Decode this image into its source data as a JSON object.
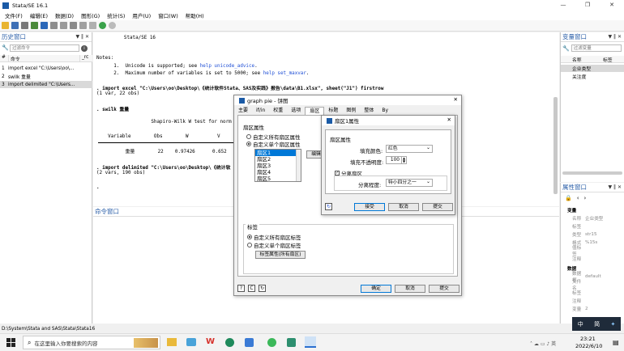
{
  "window": {
    "title": "Stata/SE 16.1",
    "min": "—",
    "max": "❐",
    "close": "✕"
  },
  "menu": [
    "文件(F)",
    "编辑(E)",
    "数据(D)",
    "图形(G)",
    "统计(S)",
    "用户(U)",
    "窗口(W)",
    "帮助(H)"
  ],
  "history": {
    "title": "历史窗口",
    "filter_placeholder": "过滤命令",
    "col_num": "#",
    "col_cmd": "命令",
    "col_rc": "_rc",
    "rows": [
      {
        "n": "1",
        "cmd": "import excel \"C:\\Users\\oo\\..."
      },
      {
        "n": "2",
        "cmd": "swilk 重量"
      },
      {
        "n": "3",
        "cmd": "import delimited \"C:\\Users..."
      }
    ]
  },
  "results": {
    "l1": "         Stata/SE 16",
    "notes": "Notes:",
    "n1a": "      1.  Unicode is supported; see ",
    "n1b": "help unicode_advice",
    "n1c": ".",
    "n2a": "      2.  Maximum number of variables is set to 5000; see ",
    "n2b": "help set_maxvar",
    "n2c": ".",
    "cmd1": ". import excel \"C:\\Users\\oo\\Desktop\\《统计软件Stata、SAS及实践》报告\\data\\B1.xlsx\", sheet(\"J1\") firstrow",
    "out1": "(1 var, 22 obs)",
    "cmd2": ". swilk 重量",
    "sw_title": "                   Shapiro-Wilk W test for norm",
    "sw_head": "    Variable        Obs        W          V",
    "sw_row": "          重量        22    0.97426      0.652",
    "cmd3": ". import delimited \"C:\\Users\\oo\\Desktop\\《统计软",
    "out3": "(2 vars, 190 obs)",
    "dot": "."
  },
  "command": {
    "title": "命令窗口"
  },
  "variables": {
    "title": "变量窗口",
    "filter_placeholder": "过滤变量",
    "col_name": "名称",
    "col_label": "标签",
    "rows": [
      "企业类型",
      "关注度"
    ]
  },
  "properties": {
    "title": "属性窗口",
    "sec_var": "变量",
    "var_rows": [
      {
        "k": "名称",
        "v": "企业类型"
      },
      {
        "k": "标签",
        "v": ""
      },
      {
        "k": "类型",
        "v": "str15"
      },
      {
        "k": "格式",
        "v": "%15s"
      },
      {
        "k": "值标签",
        "v": ""
      },
      {
        "k": "注释",
        "v": ""
      }
    ],
    "sec_data": "数据",
    "data_rows": [
      {
        "k": "数据框",
        "v": "default"
      },
      {
        "k": "文件名",
        "v": ""
      },
      {
        "k": "标签",
        "v": ""
      },
      {
        "k": "注释",
        "v": ""
      },
      {
        "k": "变量",
        "v": "2"
      }
    ]
  },
  "status": {
    "path": "D:\\System\\Stata and SAS\\Stata\\Stata16"
  },
  "taskbar": {
    "search": "在这里输入你要搜索的内容",
    "time": "23:21",
    "date": "2022/6/10"
  },
  "ime": {
    "a": "中",
    "b": "简"
  },
  "pie": {
    "title": "graph pie - 饼图",
    "tabs": [
      "主要",
      "if/in",
      "权重",
      "选项",
      "扇区",
      "标题",
      "图例",
      "整体",
      "By"
    ],
    "slice_group": "扇区属性",
    "opt_all": "自定义所有扇区属性",
    "opt_single": "自定义单个扇区属性",
    "slices": [
      "扇区1",
      "扇区2",
      "扇区3",
      "扇区4",
      "扇区5"
    ],
    "edit": "编辑",
    "label_group": "标签",
    "lbl_all": "自定义所有扇区标签",
    "lbl_single": "自定义单个扇区标签",
    "lbl_btn": "标签属性(所有扇区)",
    "ok": "确定",
    "cancel": "取消",
    "submit": "提交"
  },
  "slice1": {
    "title": "扇区1属性",
    "group": "扇区属性",
    "fill_color_label": "填充颜色:",
    "fill_color": "红色",
    "opacity_label": "填充不透明度:",
    "opacity": "100",
    "explode": "分离扇区",
    "distance_label": "分离程度:",
    "distance": "特小四分之一",
    "ok": "接受",
    "cancel": "取消",
    "submit": "提交"
  }
}
